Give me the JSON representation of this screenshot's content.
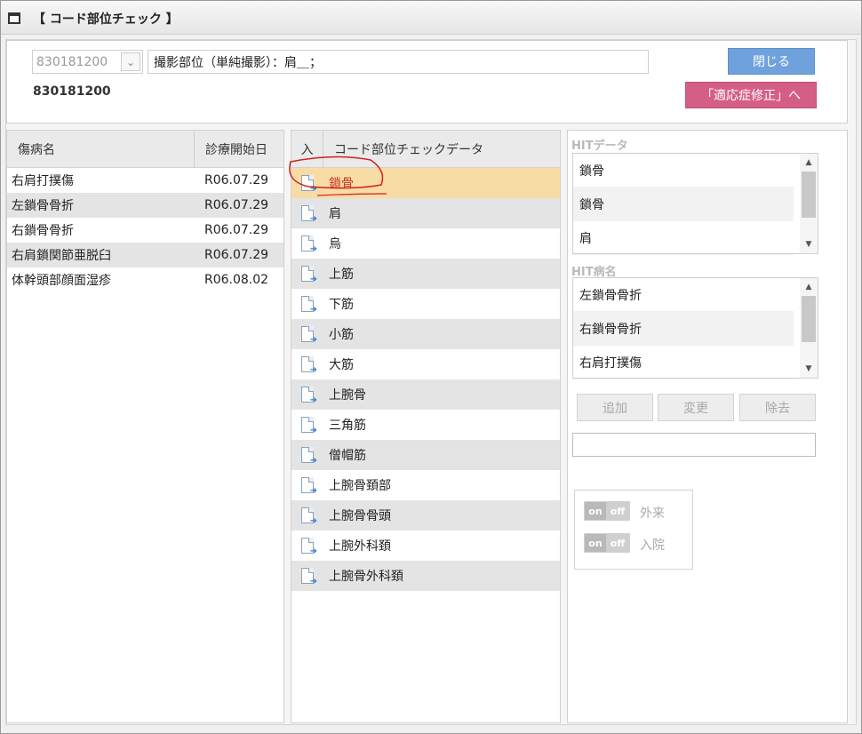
{
  "window": {
    "title": "【 コード部位チェック 】"
  },
  "header": {
    "code_select_value": "830181200",
    "part_input_value": "撮影部位（単純撮影）：肩＿；",
    "code_display": "830181200",
    "close_label": "閉じる",
    "fix_label": "「適応症修正」へ"
  },
  "left_list": {
    "col_name": "傷病名",
    "col_date": "診療開始日",
    "rows": [
      {
        "name": "右肩打撲傷",
        "date": "R06.07.29"
      },
      {
        "name": "左鎖骨骨折",
        "date": "R06.07.29"
      },
      {
        "name": "右鎖骨骨折",
        "date": "R06.07.29"
      },
      {
        "name": "右肩鎖関節亜脱臼",
        "date": "R06.07.29"
      },
      {
        "name": "体幹頭部顔面湿疹",
        "date": "R06.08.02"
      }
    ]
  },
  "middle_list": {
    "col_in": "入",
    "col_title": "コード部位チェックデータ",
    "rows": [
      "鎖骨",
      "肩",
      "烏",
      "上筋",
      "下筋",
      "小筋",
      "大筋",
      "上腕骨",
      "三角筋",
      "僧帽筋",
      "上腕骨頚部",
      "上腕骨骨頭",
      "上腕外科頚",
      "上腕骨外科頚"
    ],
    "icon": "document-arrow-icon"
  },
  "right_panel": {
    "hit_data_label": "HITデータ",
    "hit_data": [
      "鎖骨",
      "鎖骨",
      "肩"
    ],
    "hit_disease_label": "HIT病名",
    "hit_disease": [
      "左鎖骨骨折",
      "右鎖骨骨折",
      "右肩打撲傷"
    ],
    "add_label": "追加",
    "change_label": "変更",
    "remove_label": "除去",
    "text_value": "",
    "toggle_on": "on",
    "toggle_off": "off",
    "outpatient_label": "外来",
    "inpatient_label": "入院"
  },
  "colors": {
    "close_button": "#6fa2dc",
    "fix_button": "#d45f86",
    "selected_row": "#f8dca6",
    "selected_text": "#cc3322"
  }
}
